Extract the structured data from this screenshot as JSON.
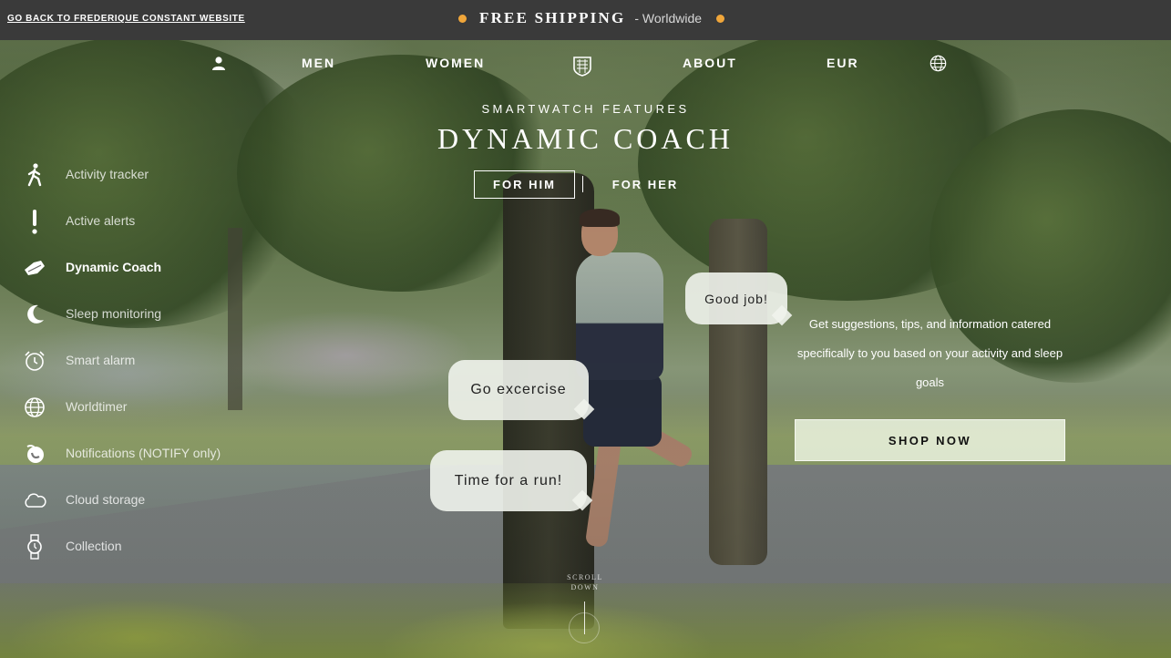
{
  "promo": {
    "back_link": "GO BACK TO FREDERIQUE CONSTANT WEBSITE",
    "title": "FREE SHIPPING",
    "subtitle": "- Worldwide",
    "dot_color": "#f0a63a"
  },
  "nav": {
    "account_icon": "user-icon",
    "men": "MEN",
    "women": "WOMEN",
    "logo_icon": "shield-logo-icon",
    "about": "ABOUT",
    "currency": "EUR",
    "language_icon": "globe-icon"
  },
  "hero": {
    "eyebrow": "SMARTWATCH FEATURES",
    "title": "DYNAMIC COACH",
    "tab_him": "FOR HIM",
    "tab_her": "FOR HER"
  },
  "sidebar": {
    "items": [
      {
        "label": "Activity tracker",
        "icon": "walking-person-icon",
        "active": false
      },
      {
        "label": "Active alerts",
        "icon": "exclamation-icon",
        "active": false
      },
      {
        "label": "Dynamic Coach",
        "icon": "running-shoe-icon",
        "active": true
      },
      {
        "label": "Sleep monitoring",
        "icon": "moon-icon",
        "active": false
      },
      {
        "label": "Smart alarm",
        "icon": "alarm-clock-icon",
        "active": false
      },
      {
        "label": "Worldtimer",
        "icon": "globe-icon",
        "active": false
      },
      {
        "label": "Notifications (NOTIFY only)",
        "icon": "notification-icon",
        "active": false
      },
      {
        "label": "Cloud storage",
        "icon": "cloud-icon",
        "active": false
      },
      {
        "label": "Collection",
        "icon": "watch-icon",
        "active": false
      }
    ]
  },
  "bubbles": {
    "good_job": "Good job!",
    "go_exercise": "Go excercise",
    "time_for_run": "Time for a run!"
  },
  "info": {
    "description": "Get suggestions, tips, and information catered specifically to you based on your activity and sleep goals",
    "shop_button": "SHOP NOW"
  },
  "scroll": {
    "line1": "SCROLL",
    "line2": "DOWN"
  }
}
